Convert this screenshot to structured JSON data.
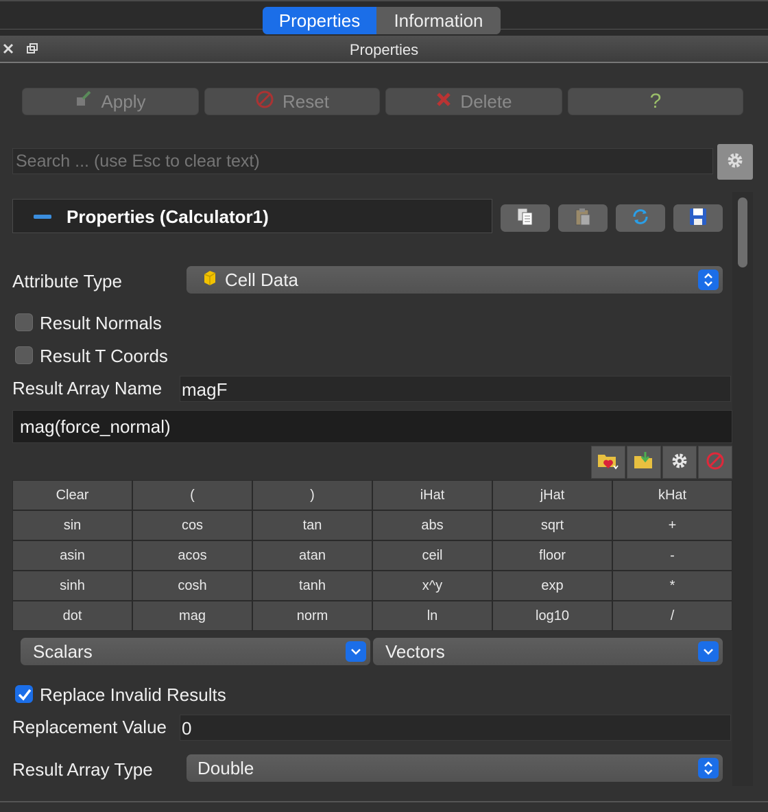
{
  "tabs": [
    {
      "label": "Properties",
      "active": true
    },
    {
      "label": "Information",
      "active": false
    }
  ],
  "dock": {
    "title": "Properties",
    "close_icon": "close-icon",
    "float_icon": "float-icon"
  },
  "actions": {
    "apply": "Apply",
    "reset": "Reset",
    "delete": "Delete",
    "help": "?"
  },
  "search": {
    "placeholder": "Search ... (use Esc to clear text)",
    "value": ""
  },
  "section": {
    "title": "Properties (Calculator1)"
  },
  "attribute_type": {
    "label": "Attribute Type",
    "value": "Cell Data"
  },
  "result_normals": {
    "label": "Result Normals",
    "checked": false
  },
  "result_tcoords": {
    "label": "Result T Coords",
    "checked": false
  },
  "result_array_name": {
    "label": "Result Array Name",
    "value": "magF"
  },
  "expression": "mag(force_normal)",
  "calculator_buttons": [
    "Clear",
    "(",
    ")",
    "iHat",
    "jHat",
    "kHat",
    "sin",
    "cos",
    "tan",
    "abs",
    "sqrt",
    "+",
    "asin",
    "acos",
    "atan",
    "ceil",
    "floor",
    "-",
    "sinh",
    "cosh",
    "tanh",
    "x^y",
    "exp",
    "*",
    "dot",
    "mag",
    "norm",
    "ln",
    "log10",
    "/"
  ],
  "scalars_combo": {
    "value": "Scalars"
  },
  "vectors_combo": {
    "value": "Vectors"
  },
  "replace_invalid": {
    "label": "Replace Invalid Results",
    "checked": true
  },
  "replacement_value": {
    "label": "Replacement Value",
    "value": "0"
  },
  "result_array_type": {
    "label": "Result Array Type",
    "value": "Double"
  },
  "colors": {
    "accent": "#1b6ee8",
    "background": "#323232"
  }
}
